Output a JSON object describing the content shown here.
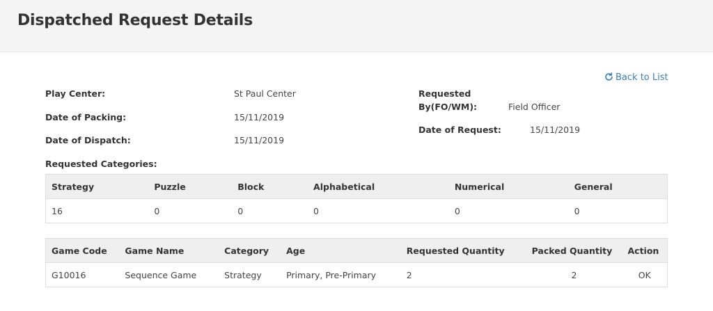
{
  "header": {
    "title": "Dispatched Request Details"
  },
  "back_link": {
    "label": "Back to List",
    "icon": "refresh-icon"
  },
  "details": {
    "play_center": {
      "label": "Play Center:",
      "value": "St Paul Center"
    },
    "date_of_packing": {
      "label": "Date of Packing:",
      "value": "15/11/2019"
    },
    "date_of_dispatch": {
      "label": "Date of Dispatch:",
      "value": "15/11/2019"
    },
    "requested_by": {
      "label_line1": "Requested",
      "label_line2": "By(FO/WM):",
      "value": "Field Officer"
    },
    "date_of_request": {
      "label": "Date of Request:",
      "value": "15/11/2019"
    }
  },
  "categories": {
    "title": "Requested Categories:",
    "headers": [
      "Strategy",
      "Puzzle",
      "Block",
      "Alphabetical",
      "Numerical",
      "General"
    ],
    "values": [
      "16",
      "0",
      "0",
      "0",
      "0",
      "0"
    ]
  },
  "games": {
    "headers": [
      "Game Code",
      "Game Name",
      "Category",
      "Age",
      "Requested Quantity",
      "Packed Quantity",
      "Action"
    ],
    "rows": [
      [
        "G10016",
        "Sequence Game",
        "Strategy",
        "Primary, Pre-Primary",
        "2",
        "2",
        "OK"
      ]
    ]
  }
}
